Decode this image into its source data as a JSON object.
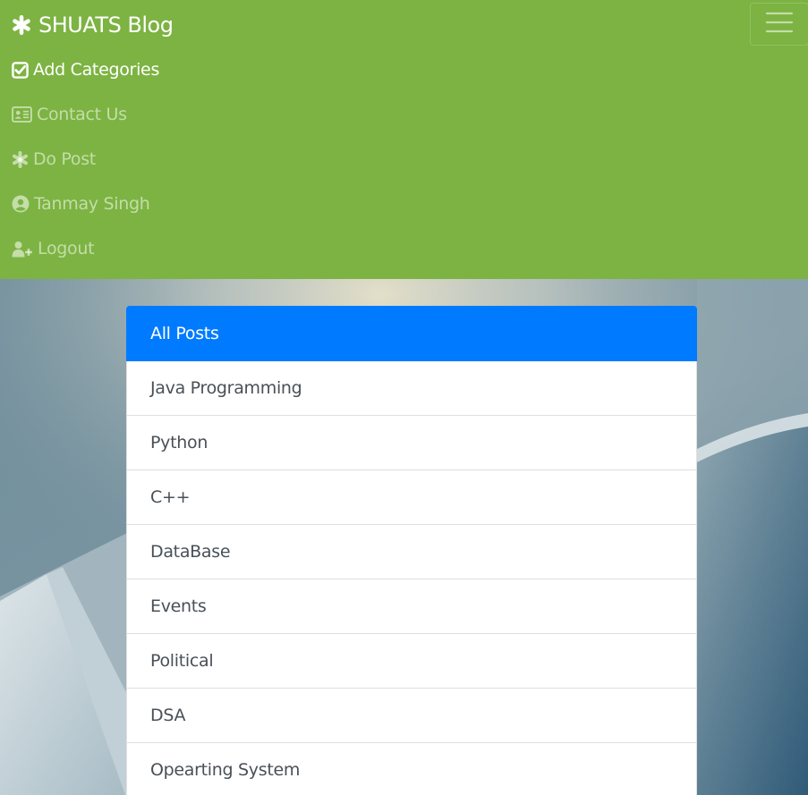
{
  "navbar": {
    "brand": "SHUATS Blog",
    "brand_icon": "asterisk-icon",
    "bg_color": "#7cb342",
    "toggler_icon": "hamburger-icon",
    "items": [
      {
        "label": "Add Categories",
        "icon": "check-square-icon",
        "active": true
      },
      {
        "label": "Contact Us",
        "icon": "address-card-icon",
        "active": false
      },
      {
        "label": "Do Post",
        "icon": "asterisk-icon",
        "active": false
      },
      {
        "label": "Tanmay Singh",
        "icon": "user-circle-icon",
        "active": false
      },
      {
        "label": "Logout",
        "icon": "user-plus-icon",
        "active": false
      }
    ]
  },
  "categories": {
    "active_color": "#007bff",
    "items": [
      {
        "label": "All Posts",
        "active": true
      },
      {
        "label": "Java Programming"
      },
      {
        "label": "Python"
      },
      {
        "label": "C++"
      },
      {
        "label": "DataBase"
      },
      {
        "label": "Events"
      },
      {
        "label": "Political"
      },
      {
        "label": "DSA"
      },
      {
        "label": "Opearting System"
      }
    ]
  }
}
